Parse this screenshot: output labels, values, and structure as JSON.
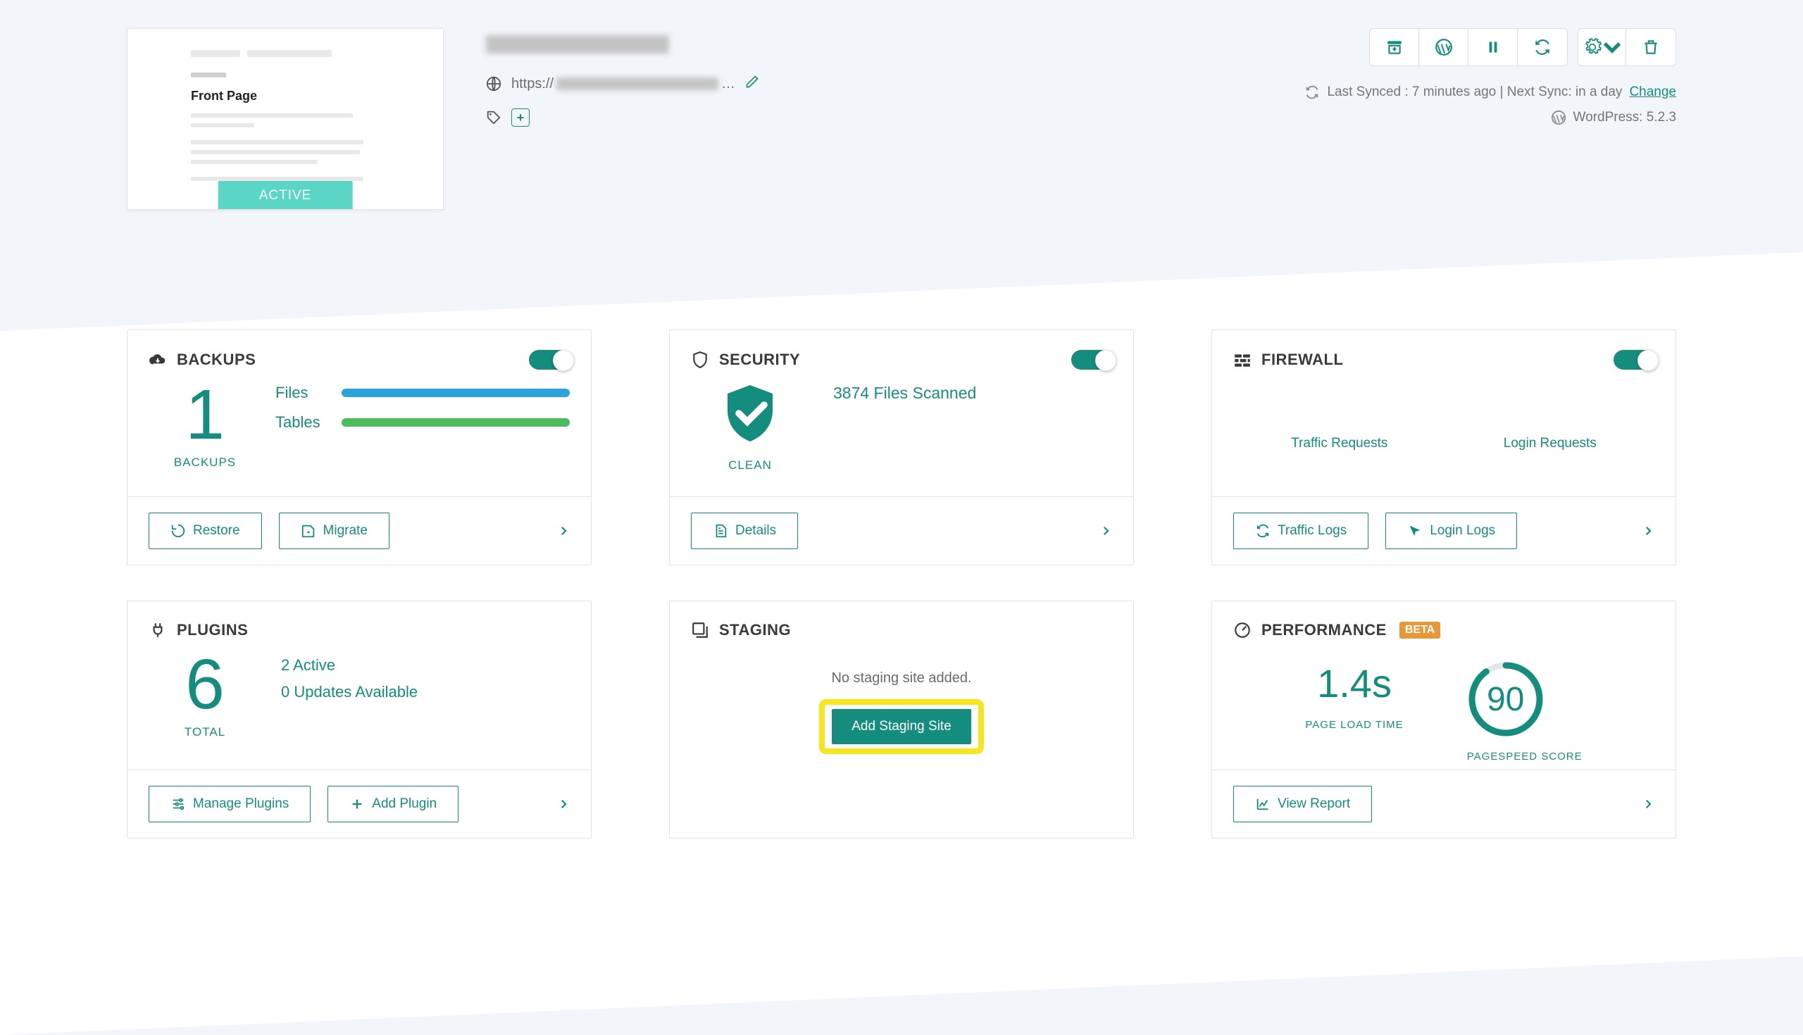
{
  "header": {
    "status_badge": "ACTIVE",
    "thumb_heading": "Front Page",
    "url_prefix": "https://",
    "url_suffix": "…",
    "sync_prefix": "Last Synced : ",
    "sync_ago": "7 minutes ago",
    "sync_sep": " | ",
    "next_sync_label": "Next Sync: ",
    "next_sync_value": "in a day",
    "change_link": "Change",
    "wp_prefix": "WordPress: ",
    "wp_version": "5.2.3"
  },
  "backups": {
    "title": "BACKUPS",
    "count": "1",
    "sub": "BACKUPS",
    "files_label": "Files",
    "tables_label": "Tables",
    "restore_btn": "Restore",
    "migrate_btn": "Migrate"
  },
  "security": {
    "title": "SECURITY",
    "status": "CLEAN",
    "summary": "3874 Files Scanned",
    "details_btn": "Details"
  },
  "firewall": {
    "title": "FIREWALL",
    "traffic_label": "Traffic Requests",
    "login_label": "Login Requests",
    "traffic_logs_btn": "Traffic Logs",
    "login_logs_btn": "Login Logs"
  },
  "plugins": {
    "title": "PLUGINS",
    "count": "6",
    "sub": "TOTAL",
    "active_line": "2 Active",
    "updates_line": "0 Updates Available",
    "manage_btn": "Manage Plugins",
    "add_btn": "Add Plugin"
  },
  "staging": {
    "title": "STAGING",
    "msg": "No staging site added.",
    "add_btn": "Add Staging Site"
  },
  "performance": {
    "title": "PERFORMANCE",
    "beta": "BETA",
    "load_time": "1.4s",
    "load_label": "PAGE LOAD TIME",
    "score": "90",
    "score_label": "PAGESPEED SCORE",
    "report_btn": "View Report"
  }
}
